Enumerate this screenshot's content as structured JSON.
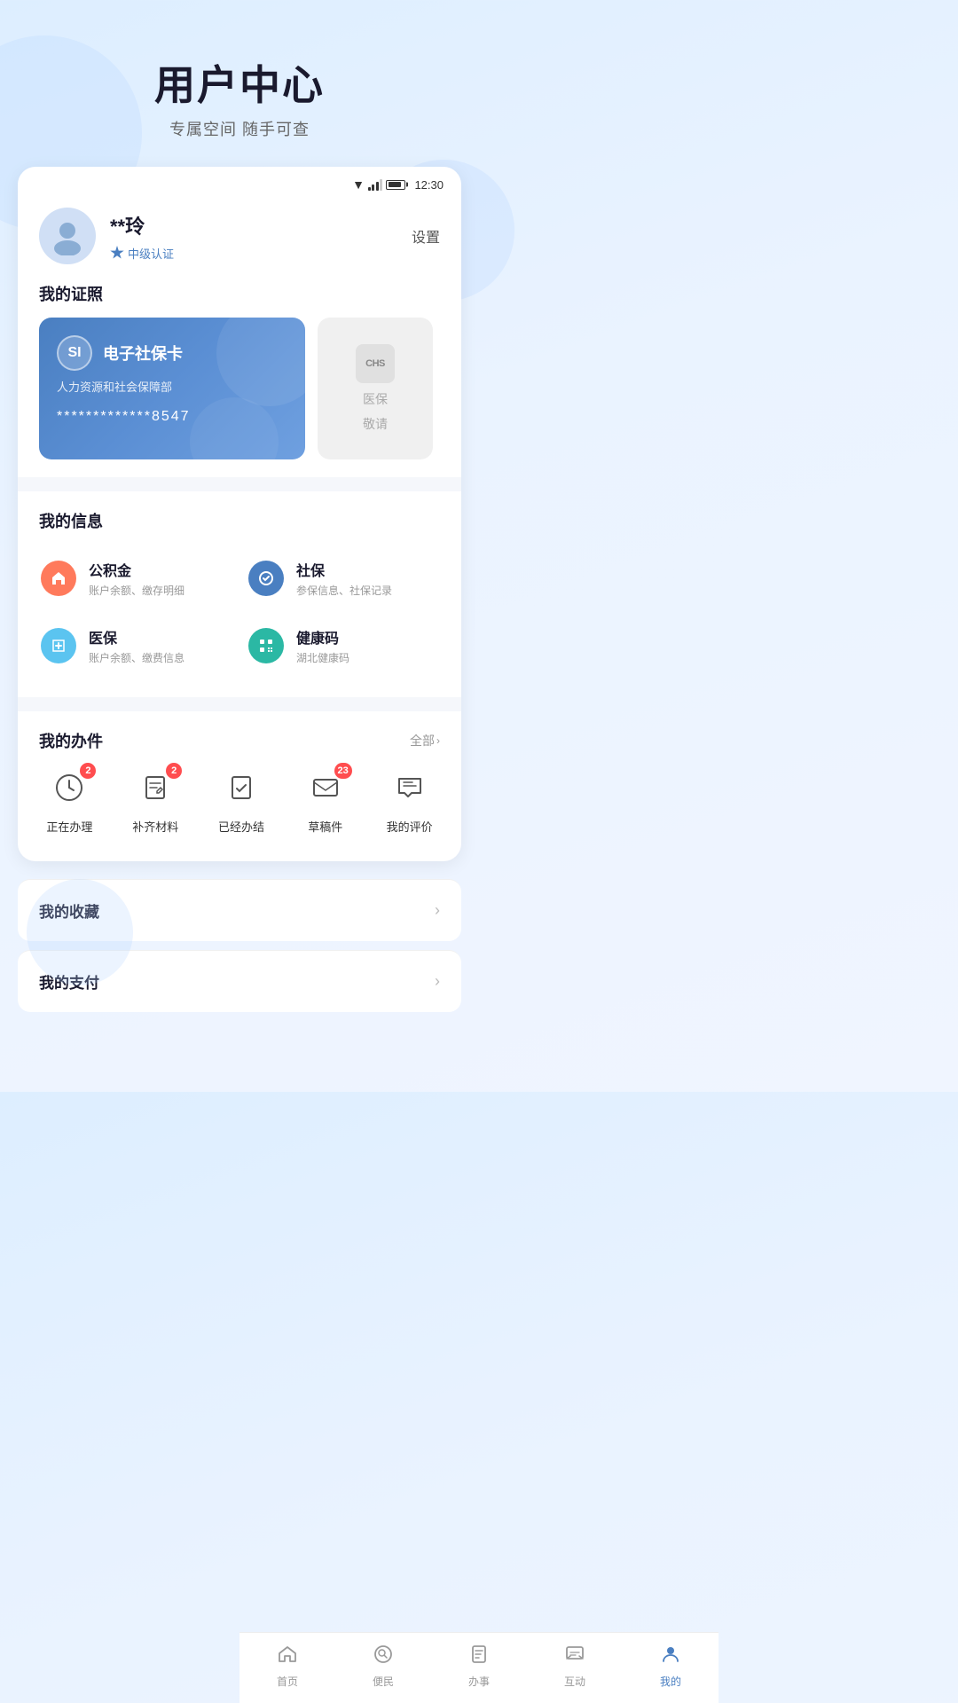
{
  "page": {
    "title": "用户中心",
    "subtitle": "专属空间 随手可查"
  },
  "statusBar": {
    "time": "12:30"
  },
  "profile": {
    "name": "**玲",
    "settings_label": "设置",
    "certification": "中级认证"
  },
  "myCards": {
    "section_title": "我的证照",
    "social_card": {
      "logo_text": "SI",
      "name": "电子社保卡",
      "org": "人力资源和社会保障部",
      "number": "*************8547"
    },
    "medical_card": {
      "logo_text": "CHS",
      "text": "医保",
      "subtext": "敬请"
    }
  },
  "myInfo": {
    "section_title": "我的信息",
    "items": [
      {
        "label": "公积金",
        "desc": "账户余额、缴存明细",
        "icon_type": "gjj"
      },
      {
        "label": "社保",
        "desc": "参保信息、社保记录",
        "icon_type": "sb"
      },
      {
        "label": "医保",
        "desc": "账户余额、缴费信息",
        "icon_type": "yb"
      },
      {
        "label": "健康码",
        "desc": "湖北健康码",
        "icon_type": "jkm"
      }
    ]
  },
  "myTasks": {
    "section_title": "我的办件",
    "view_all_label": "全部",
    "items": [
      {
        "label": "正在办理",
        "badge": "2",
        "icon": "clock"
      },
      {
        "label": "补齐材料",
        "badge": "2",
        "icon": "doc-edit"
      },
      {
        "label": "已经办结",
        "badge": null,
        "icon": "doc-check"
      },
      {
        "label": "草稿件",
        "badge": "23",
        "icon": "mail"
      },
      {
        "label": "我的评价",
        "badge": null,
        "icon": "comment"
      }
    ]
  },
  "myCollections": {
    "label": "我的收藏"
  },
  "myPayment": {
    "label": "我的支付"
  },
  "bottomNav": {
    "items": [
      {
        "label": "首页",
        "icon": "home",
        "active": false
      },
      {
        "label": "便民",
        "icon": "search-circle",
        "active": false
      },
      {
        "label": "办事",
        "icon": "doc",
        "active": false
      },
      {
        "label": "互动",
        "icon": "chat",
        "active": false
      },
      {
        "label": "我的",
        "icon": "user",
        "active": true
      }
    ]
  }
}
